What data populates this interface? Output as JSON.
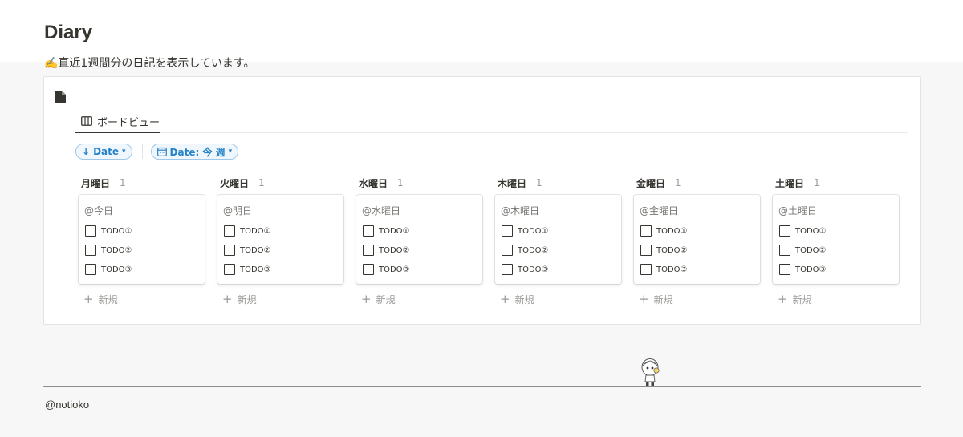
{
  "page": {
    "title": "Diary",
    "description": "✍️直近1週間分の日記を表示しています。"
  },
  "database": {
    "icon": "document-icon",
    "tabs": [
      {
        "label": "ボードビュー",
        "icon": "board-view-icon",
        "active": true
      }
    ],
    "sort_label": "Date",
    "filter_label": "Date: 今 週",
    "columns": [
      {
        "name": "月曜日",
        "count": "1",
        "card": {
          "date": "@今日",
          "todos": [
            "TODO①",
            "TODO②",
            "TODO③"
          ]
        }
      },
      {
        "name": "火曜日",
        "count": "1",
        "card": {
          "date": "@明日",
          "todos": [
            "TODO①",
            "TODO②",
            "TODO③"
          ]
        }
      },
      {
        "name": "水曜日",
        "count": "1",
        "card": {
          "date": "@水曜日",
          "todos": [
            "TODO①",
            "TODO②",
            "TODO③"
          ]
        }
      },
      {
        "name": "木曜日",
        "count": "1",
        "card": {
          "date": "@木曜日",
          "todos": [
            "TODO①",
            "TODO②",
            "TODO③"
          ]
        }
      },
      {
        "name": "金曜日",
        "count": "1",
        "card": {
          "date": "@金曜日",
          "todos": [
            "TODO①",
            "TODO②",
            "TODO③"
          ]
        }
      },
      {
        "name": "土曜日",
        "count": "1",
        "card": {
          "date": "@土曜日",
          "todos": [
            "TODO①",
            "TODO②",
            "TODO③"
          ]
        }
      }
    ],
    "new_label": "新規"
  },
  "footer": {
    "handle": "@notioko"
  },
  "colors": {
    "accent_blue": "#2783c9",
    "text": "#37352f",
    "muted": "#9b9a97",
    "background": "#f7f7f7"
  }
}
